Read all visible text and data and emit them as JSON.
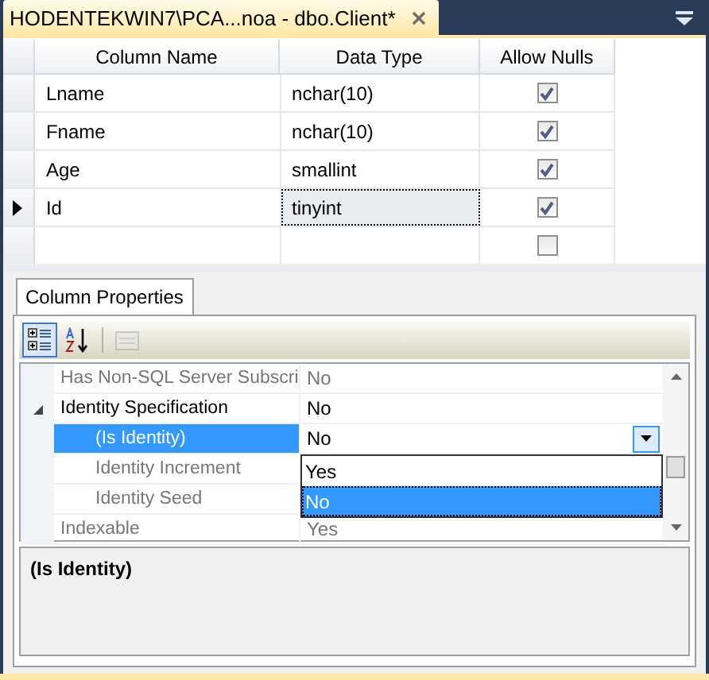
{
  "document_tab": {
    "title": "HODENTEKWIN7\\PCA...noa - dbo.Client*"
  },
  "table": {
    "columns": [
      "Column Name",
      "Data Type",
      "Allow Nulls"
    ],
    "rows": [
      {
        "name": "Lname",
        "data_type": "nchar(10)",
        "allow_nulls": true,
        "current": false,
        "focused": false
      },
      {
        "name": "Fname",
        "data_type": "nchar(10)",
        "allow_nulls": true,
        "current": false,
        "focused": false
      },
      {
        "name": "Age",
        "data_type": "smallint",
        "allow_nulls": true,
        "current": false,
        "focused": false
      },
      {
        "name": "Id",
        "data_type": "tinyint",
        "allow_nulls": true,
        "current": true,
        "focused": true
      },
      {
        "allow_nulls": false,
        "current": false,
        "focused": false
      }
    ]
  },
  "column_properties": {
    "tab": "Column Properties",
    "toolbar": [
      {
        "kind": "categorized",
        "selected": true
      },
      {
        "kind": "alphabetical",
        "selected": false
      },
      {
        "kind": "property-pages",
        "disabled": true
      }
    ],
    "properties": [
      {
        "name": "Has Non-SQL Server Subscri",
        "value": "No",
        "disabled": true,
        "selected": false
      },
      {
        "name": "Identity Specification",
        "value": "No",
        "disabled": false,
        "selected": false,
        "expanded": true,
        "children": [
          {
            "name": "(Is Identity)",
            "value": "No",
            "disabled": false,
            "selected": true,
            "options": [
              {
                "label": "Yes",
                "selected": false
              },
              {
                "label": "No",
                "selected": true
              }
            ]
          },
          {
            "name": "Identity Increment",
            "disabled": true,
            "selected": false
          },
          {
            "name": "Identity Seed",
            "disabled": true,
            "selected": false
          }
        ]
      },
      {
        "name": "Indexable",
        "value": "Yes",
        "disabled": true,
        "selected": false
      }
    ],
    "description": {
      "title": "(Is Identity)"
    }
  }
}
